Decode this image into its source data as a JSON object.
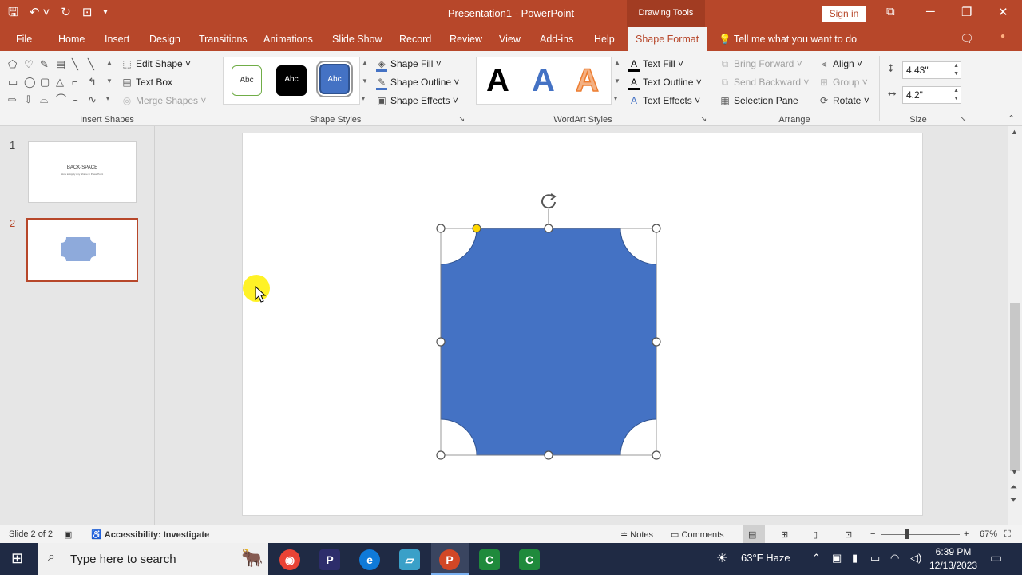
{
  "title_bar": {
    "document_title": "Presentation1  -  PowerPoint",
    "contextual_group": "Drawing Tools",
    "sign_in": "Sign in"
  },
  "tabs": [
    "File",
    "Home",
    "Insert",
    "Design",
    "Transitions",
    "Animations",
    "Slide Show",
    "Record",
    "Review",
    "View",
    "Add-ins",
    "Help",
    "Shape Format"
  ],
  "active_tab": "Shape Format",
  "tell_me": "Tell me what you want to do",
  "ribbon": {
    "insert_shapes": {
      "label": "Insert Shapes",
      "edit_shape": "Edit Shape",
      "text_box": "Text Box",
      "merge_shapes": "Merge Shapes"
    },
    "shape_styles": {
      "label": "Shape Styles",
      "swatch_text": "Abc",
      "shape_fill": "Shape Fill",
      "shape_outline": "Shape Outline",
      "shape_effects": "Shape Effects"
    },
    "wordart_styles": {
      "label": "WordArt Styles",
      "letter": "A",
      "text_fill": "Text Fill",
      "text_outline": "Text Outline",
      "text_effects": "Text Effects"
    },
    "arrange": {
      "label": "Arrange",
      "bring_forward": "Bring Forward",
      "send_backward": "Send Backward",
      "selection_pane": "Selection Pane",
      "align": "Align",
      "group": "Group",
      "rotate": "Rotate"
    },
    "size": {
      "label": "Size",
      "height": "4.43\"",
      "width": "4.2\""
    }
  },
  "slides": [
    {
      "number": "1",
      "title": "BACK-SPACE",
      "subtitle": "How to Apply Any Shape in PowerPoint"
    },
    {
      "number": "2"
    }
  ],
  "status": {
    "slide_info": "Slide 2 of 2",
    "accessibility": "Accessibility: Investigate",
    "notes": "Notes",
    "comments": "Comments",
    "zoom": "67%"
  },
  "taskbar": {
    "search_placeholder": "Type here to search",
    "weather": "63°F  Haze",
    "time": "6:39 PM",
    "date": "12/13/2023"
  },
  "colors": {
    "accent": "#b7472a",
    "shape_fill": "#4472c4"
  }
}
